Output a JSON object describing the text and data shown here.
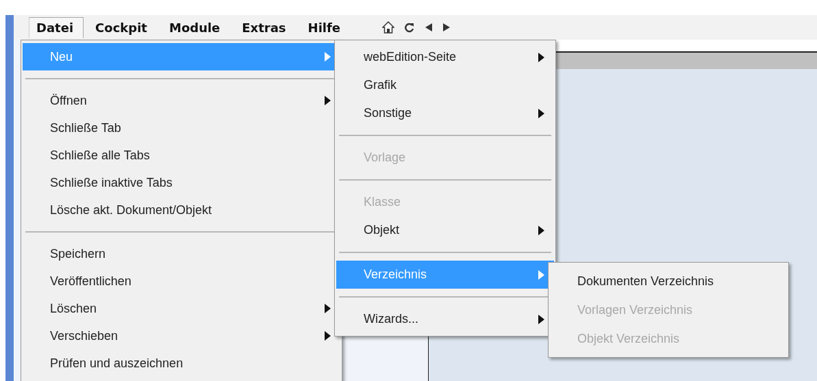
{
  "menu_bar": {
    "items": [
      {
        "label": "Datei",
        "selected": true
      },
      {
        "label": "Cockpit",
        "selected": false
      },
      {
        "label": "Module",
        "selected": false
      },
      {
        "label": "Extras",
        "selected": false
      },
      {
        "label": "Hilfe",
        "selected": false
      }
    ]
  },
  "file_menu": {
    "items": [
      {
        "kind": "item",
        "label": "Neu",
        "selected": true,
        "submenu": true,
        "disabled": false
      },
      {
        "kind": "separator"
      },
      {
        "kind": "item",
        "label": "Öffnen",
        "selected": false,
        "submenu": true,
        "disabled": false
      },
      {
        "kind": "item",
        "label": "Schließe Tab",
        "selected": false,
        "submenu": false,
        "disabled": false
      },
      {
        "kind": "item",
        "label": "Schließe alle Tabs",
        "selected": false,
        "submenu": false,
        "disabled": false
      },
      {
        "kind": "item",
        "label": "Schließe inaktive Tabs",
        "selected": false,
        "submenu": false,
        "disabled": false
      },
      {
        "kind": "item",
        "label": "Lösche akt. Dokument/Objekt",
        "selected": false,
        "submenu": false,
        "disabled": false
      },
      {
        "kind": "separator"
      },
      {
        "kind": "item",
        "label": "Speichern",
        "selected": false,
        "submenu": false,
        "disabled": false
      },
      {
        "kind": "item",
        "label": "Veröffentlichen",
        "selected": false,
        "submenu": false,
        "disabled": false
      },
      {
        "kind": "item",
        "label": "Löschen",
        "selected": false,
        "submenu": true,
        "disabled": false
      },
      {
        "kind": "item",
        "label": "Verschieben",
        "selected": false,
        "submenu": true,
        "disabled": false
      },
      {
        "kind": "item",
        "label": "Prüfen und auszeichnen",
        "selected": false,
        "submenu": false,
        "disabled": false
      }
    ]
  },
  "new_menu": {
    "items": [
      {
        "kind": "item",
        "label": "webEdition-Seite",
        "selected": false,
        "submenu": true,
        "disabled": false
      },
      {
        "kind": "item",
        "label": "Grafik",
        "selected": false,
        "submenu": false,
        "disabled": false
      },
      {
        "kind": "item",
        "label": "Sonstige",
        "selected": false,
        "submenu": true,
        "disabled": false
      },
      {
        "kind": "separator"
      },
      {
        "kind": "item",
        "label": "Vorlage",
        "selected": false,
        "submenu": false,
        "disabled": true
      },
      {
        "kind": "separator"
      },
      {
        "kind": "item",
        "label": "Klasse",
        "selected": false,
        "submenu": false,
        "disabled": true
      },
      {
        "kind": "item",
        "label": "Objekt",
        "selected": false,
        "submenu": true,
        "disabled": false
      },
      {
        "kind": "separator"
      },
      {
        "kind": "item",
        "label": "Verzeichnis",
        "selected": true,
        "submenu": true,
        "disabled": false
      },
      {
        "kind": "separator"
      },
      {
        "kind": "item",
        "label": "Wizards...",
        "selected": false,
        "submenu": true,
        "disabled": false
      }
    ]
  },
  "folder_menu": {
    "items": [
      {
        "kind": "item",
        "label": "Dokumenten Verzeichnis",
        "selected": false,
        "submenu": false,
        "disabled": false
      },
      {
        "kind": "item",
        "label": "Vorlagen Verzeichnis",
        "selected": false,
        "submenu": false,
        "disabled": true
      },
      {
        "kind": "item",
        "label": "Objekt Verzeichnis",
        "selected": false,
        "submenu": false,
        "disabled": true
      }
    ]
  }
}
